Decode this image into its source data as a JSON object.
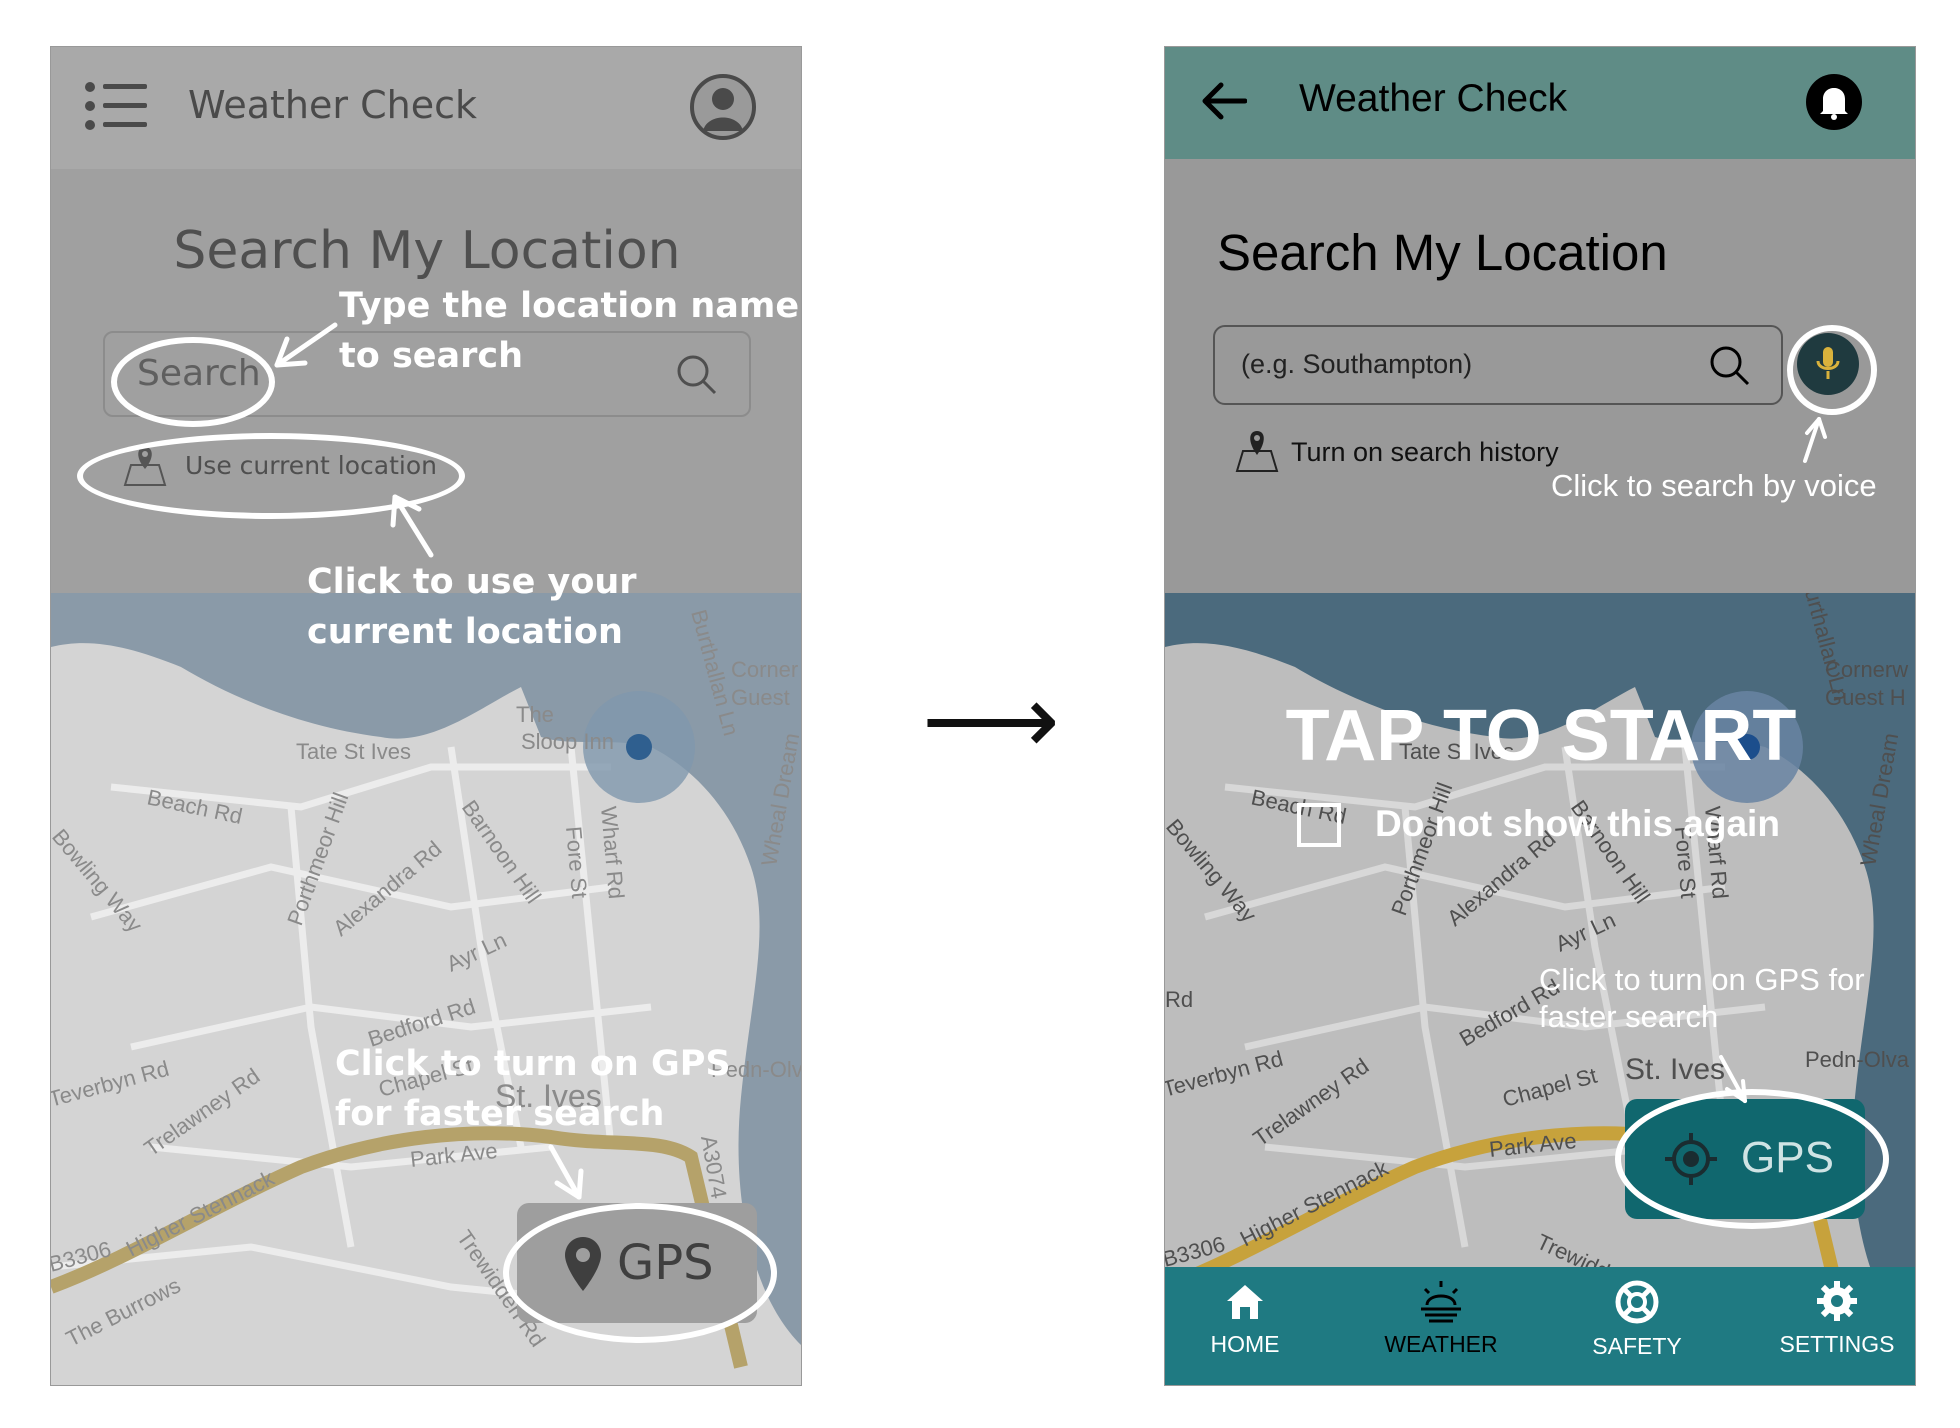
{
  "left_screen": {
    "app_title": "Weather Check",
    "page_title": "Search My Location",
    "search_placeholder": "Search",
    "use_current_location": "Use current location",
    "gps_label": "GPS",
    "annotations": {
      "type_location": "Type the location name\nto search",
      "use_current": "Click to use your\ncurrent location",
      "gps": "Click to turn on GPS\nfor faster search"
    }
  },
  "arrow": "⟶",
  "right_screen": {
    "app_title": "Weather Check",
    "page_title": "Search My Location",
    "search_placeholder": "(e.g. Southampton)",
    "search_history": "Turn on search history",
    "tap_to_start": "TAP TO START",
    "do_not_show": "Do not show this again",
    "gps_label": "GPS",
    "annotations": {
      "voice": "Click to search by voice",
      "gps": "Click to turn on GPS for\nfaster search"
    },
    "nav": [
      {
        "label": "HOME",
        "icon": "home-icon"
      },
      {
        "label": "WEATHER",
        "icon": "weather-icon"
      },
      {
        "label": "SAFETY",
        "icon": "lifebuoy-icon"
      },
      {
        "label": "SETTINGS",
        "icon": "gear-icon"
      }
    ]
  },
  "map_labels": {
    "tate": "Tate St Ives",
    "sloop": "The\nSloop Inn",
    "beach": "Beach Rd",
    "porthmeor": "Porthmeor Hill",
    "alexandra": "Alexandra Rd",
    "barnoon": "Barnoon Hill",
    "fore": "Fore St",
    "wharf": "Wharf Rd",
    "ayr": "Ayr Ln",
    "bedford": "Bedford Rd",
    "trelawney": "Trelawney Rd",
    "chapel": "Chapel St",
    "stives": "St. Ives",
    "park": "Park Ave",
    "stennack": "Higher Stennack",
    "burrows": "The Burrows",
    "trewidden": "Trewidden Rd",
    "pedn": "Pedn-Olva",
    "wheal": "Wheal Dream",
    "corner": "Cornerways\nGuest House",
    "burthallan": "Burthallan Ln",
    "a3074": "A3074",
    "b3306": "B3306",
    "bw": "Bowling Way",
    "everbyn": "Teverbyn Rd",
    "rd": "Rd"
  },
  "colors": {
    "left_overlay": "#808080",
    "right_header": "#5f8c86",
    "right_nav": "#1f7a82",
    "gps_button_right": "#10676e",
    "water": "#5d8aa8",
    "land": "#d9d9d9",
    "road_major": "#e8c86a"
  }
}
